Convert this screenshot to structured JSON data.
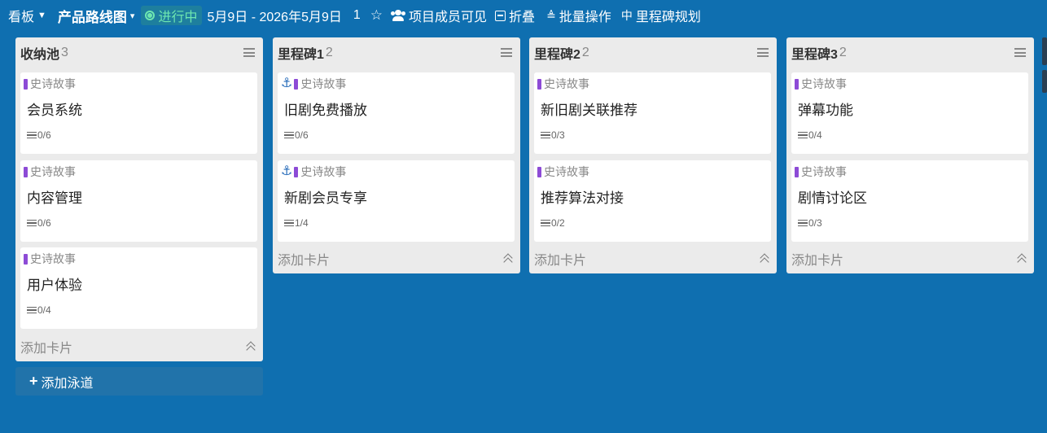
{
  "colors": {
    "background": "#0f6fb0",
    "status": "#6ee7b0",
    "tag": "#8d4bd6",
    "lane": "#ebebeb"
  },
  "topbar": {
    "view_label": "看板",
    "project_title": "产品路线图",
    "status": "进行中",
    "date_range": "5月9日 - 2026年5月9日",
    "count": "1",
    "visibility": "项目成员可见",
    "collapse": "折叠",
    "batch": "批量操作",
    "milestone_plan": "里程碑规划",
    "icons": [
      "chevron-down-icon",
      "caret-down-icon",
      "status-dot-icon",
      "star-icon",
      "members-icon",
      "collapse-icon",
      "list-check-icon",
      "milestone-icon"
    ]
  },
  "lanes": [
    {
      "name": "收纳池",
      "count": "3",
      "cards": [
        {
          "tag": "史诗故事",
          "title": "会员系统",
          "progress": "0/6"
        },
        {
          "tag": "史诗故事",
          "title": "内容管理",
          "progress": "0/6"
        },
        {
          "tag": "史诗故事",
          "title": "用户体验",
          "progress": "0/4"
        }
      ],
      "add_card": "添加卡片"
    },
    {
      "name": "里程碑1",
      "count": "2",
      "cards": [
        {
          "tag": "史诗故事",
          "title": "旧剧免费播放",
          "progress": "0/6"
        },
        {
          "tag": "史诗故事",
          "title": "新剧会员专享",
          "progress": "1/4"
        }
      ],
      "add_card": "添加卡片"
    },
    {
      "name": "里程碑2",
      "count": "2",
      "cards": [
        {
          "tag": "史诗故事",
          "title": "新旧剧关联推荐",
          "progress": "0/3"
        },
        {
          "tag": "史诗故事",
          "title": "推荐算法对接",
          "progress": "0/2"
        }
      ],
      "add_card": "添加卡片"
    },
    {
      "name": "里程碑3",
      "count": "2",
      "cards": [
        {
          "tag": "史诗故事",
          "title": "弹幕功能",
          "progress": "0/4"
        },
        {
          "tag": "史诗故事",
          "title": "剧情讨论区",
          "progress": "0/3"
        }
      ],
      "add_card": "添加卡片"
    }
  ],
  "add_lane": "添加泳道"
}
